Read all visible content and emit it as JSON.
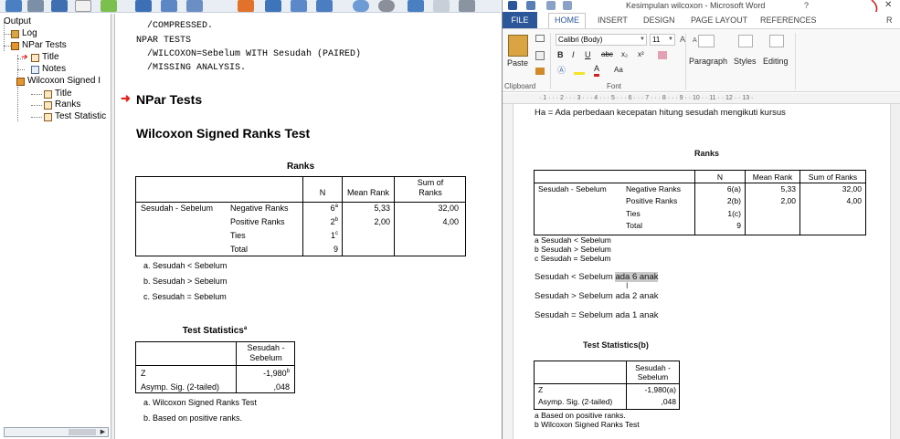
{
  "spss": {
    "outline": {
      "items": [
        {
          "label": "Output"
        },
        {
          "label": "Log"
        },
        {
          "label": "NPar Tests"
        },
        {
          "label": "Title"
        },
        {
          "label": "Notes"
        },
        {
          "label": "Wilcoxon Signed I"
        },
        {
          "label": "Title"
        },
        {
          "label": "Ranks"
        },
        {
          "label": "Test Statistic"
        }
      ]
    },
    "syntax": {
      "line1": "/COMPRESSED.",
      "line2": "NPAR TESTS",
      "line3": "/WILCOXON=Sebelum WITH Sesudah (PAIRED)",
      "line4": "/MISSING ANALYSIS."
    },
    "heading_npar": "NPar Tests",
    "heading_wilcoxon": "Wilcoxon Signed Ranks Test",
    "ranks": {
      "caption": "Ranks",
      "col_n": "N",
      "col_mean": "Mean Rank",
      "col_sum_1": "Sum of",
      "col_sum_2": "Ranks",
      "pair_label": "Sesudah - Sebelum",
      "rows": [
        {
          "label": "Negative Ranks",
          "n": "6",
          "sup": "a",
          "mean": "5,33",
          "sum": "32,00"
        },
        {
          "label": "Positive Ranks",
          "n": "2",
          "sup": "b",
          "mean": "2,00",
          "sum": "4,00"
        },
        {
          "label": "Ties",
          "n": "1",
          "sup": "c",
          "mean": "",
          "sum": ""
        },
        {
          "label": "Total",
          "n": "9",
          "sup": "",
          "mean": "",
          "sum": ""
        }
      ],
      "footnotes": [
        "a. Sesudah < Sebelum",
        "b. Sesudah > Sebelum",
        "c. Sesudah = Sebelum"
      ]
    },
    "test_stats": {
      "caption": "Test Statistics",
      "caption_sup": "a",
      "col_1": "Sesudah -",
      "col_2": "Sebelum",
      "z_label": "Z",
      "z_value": "-1,980",
      "z_sup": "b",
      "sig_label": "Asymp. Sig. (2-tailed)",
      "sig_value": ",048",
      "footnotes": [
        "a. Wilcoxon Signed Ranks Test",
        "b. Based on positive ranks."
      ]
    }
  },
  "word": {
    "title": "Kesimpulan wilcoxon - Microsoft Word",
    "help": "?",
    "close": "✕",
    "tabs": {
      "file": "FILE",
      "home": "HOME",
      "insert": "INSERT",
      "design": "DESIGN",
      "page_layout": "PAGE LAYOUT",
      "references": "REFERENCES",
      "more": "R"
    },
    "ribbon": {
      "paste": "Paste",
      "clipboard": "Clipboard",
      "font_name": "Calibri (Body)",
      "font_size": "11",
      "font_group": "Font",
      "paragraph": "Paragraph",
      "styles": "Styles",
      "editing": "Editing",
      "bold": "B",
      "italic": "I",
      "underline": "U",
      "strike": "abc",
      "subscript": "x₂",
      "superscript": "x²",
      "change_case": "Aa",
      "grow": "A",
      "shrink": "A"
    },
    "ruler": "· 1 · · · 2 · · · 3 · · · 4 · · · 5 · · · 6 · · · 7 · · · 8 · · · 9 · · 10 · · 11 · · 12 · · 13 ·",
    "doc": {
      "ha_line": "Ha = Ada perbedaan kecepatan hitung sesudah mengikuti kursus",
      "ranks_caption": "Ranks",
      "col_n": "N",
      "col_mean": "Mean Rank",
      "col_sum": "Sum of Ranks",
      "pair_label": "Sesudah - Sebelum",
      "rows": [
        {
          "label": "Negative Ranks",
          "n": "6(a)",
          "mean": "5,33",
          "sum": "32,00"
        },
        {
          "label": "Positive Ranks",
          "n": "2(b)",
          "mean": "2,00",
          "sum": "4,00"
        },
        {
          "label": "Ties",
          "n": "1(c)",
          "mean": "",
          "sum": ""
        },
        {
          "label": "Total",
          "n": "9",
          "mean": "",
          "sum": ""
        }
      ],
      "footnotes": [
        "a  Sesudah < Sebelum",
        "b  Sesudah > Sebelum",
        "c  Sesudah = Sebelum"
      ],
      "line_less_prefix": "Sesudah < Sebelum ",
      "line_less_highlight": "ada 6 anak",
      "line_greater": "Sesudah > Sebelum ada 2 anak",
      "line_equal": "Sesudah = Sebelum ada 1 anak",
      "ts_caption": "Test Statistics(b)",
      "ts_col_1": "Sesudah -",
      "ts_col_2": "Sebelum",
      "ts_z_label": "Z",
      "ts_z_value": "-1,980(a)",
      "ts_sig_label": "Asymp. Sig. (2-tailed)",
      "ts_sig_value": ",048",
      "ts_footnotes": [
        "a  Based on positive ranks.",
        "b  Wilcoxon Signed Ranks Test"
      ]
    }
  },
  "colors": {
    "word_blue": "#2b579a",
    "spss_arrow": "#e0241b",
    "highlight": "#c9c9c9"
  }
}
